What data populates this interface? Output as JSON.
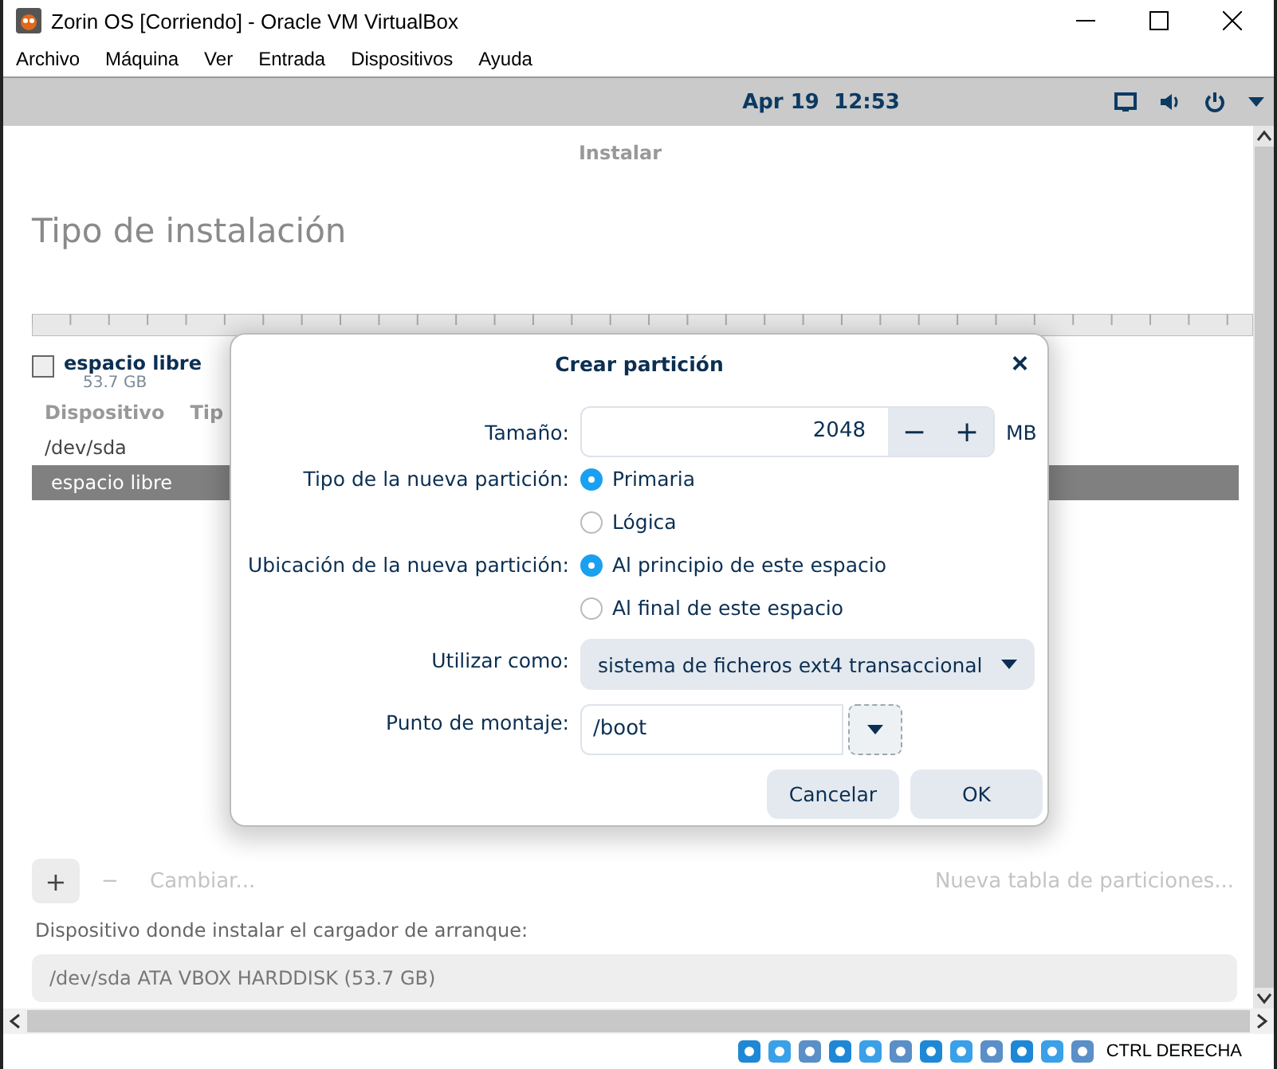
{
  "window": {
    "title": "Zorin OS [Corriendo] - Oracle VM VirtualBox"
  },
  "menu": [
    "Archivo",
    "Máquina",
    "Ver",
    "Entrada",
    "Dispositivos",
    "Ayuda"
  ],
  "guest_topbar": {
    "date": "Apr 19",
    "time": "12:53"
  },
  "page": {
    "header": "Instalar",
    "title": "Tipo de instalación",
    "legend": {
      "label": "espacio libre",
      "size": "53.7 GB",
      "checked": false
    },
    "table": {
      "columns": [
        "Dispositivo",
        "Tip"
      ],
      "rows": [
        {
          "device": "/dev/sda",
          "selected": false
        },
        {
          "device": "espacio libre",
          "selected": true
        }
      ]
    },
    "toolbar": [
      {
        "label": "+",
        "disabled": false
      },
      {
        "label": "−",
        "disabled": true
      },
      {
        "label": "Cambiar...",
        "disabled": true
      },
      {
        "label": "Nueva tabla de particiones...",
        "disabled": true
      }
    ],
    "bootloader": {
      "label": "Dispositivo donde instalar el cargador de arranque:",
      "value": "/dev/sda ATA VBOX HARDDISK (53.7 GB)"
    }
  },
  "dialog": {
    "title": "Crear partición",
    "close": "×",
    "size": {
      "label": "Tamaño:",
      "value": "2048",
      "minus": "−",
      "plus": "+",
      "unit": "MB"
    },
    "type": {
      "label": "Tipo de la nueva partición:",
      "options": [
        {
          "label": "Primaria",
          "selected": true
        },
        {
          "label": "Lógica",
          "selected": false
        }
      ]
    },
    "location": {
      "label": "Ubicación de la nueva partición:",
      "options": [
        {
          "label": "Al principio de este espacio",
          "selected": true
        },
        {
          "label": "Al final de este espacio",
          "selected": false
        }
      ]
    },
    "use_as": {
      "label": "Utilizar como:",
      "value": "sistema de ficheros ext4 transaccional"
    },
    "mount": {
      "label": "Punto de montaje:",
      "value": "/boot"
    },
    "buttons": [
      "Cancelar",
      "OK"
    ]
  },
  "status_bar": {
    "host_key": "CTRL DERECHA"
  }
}
